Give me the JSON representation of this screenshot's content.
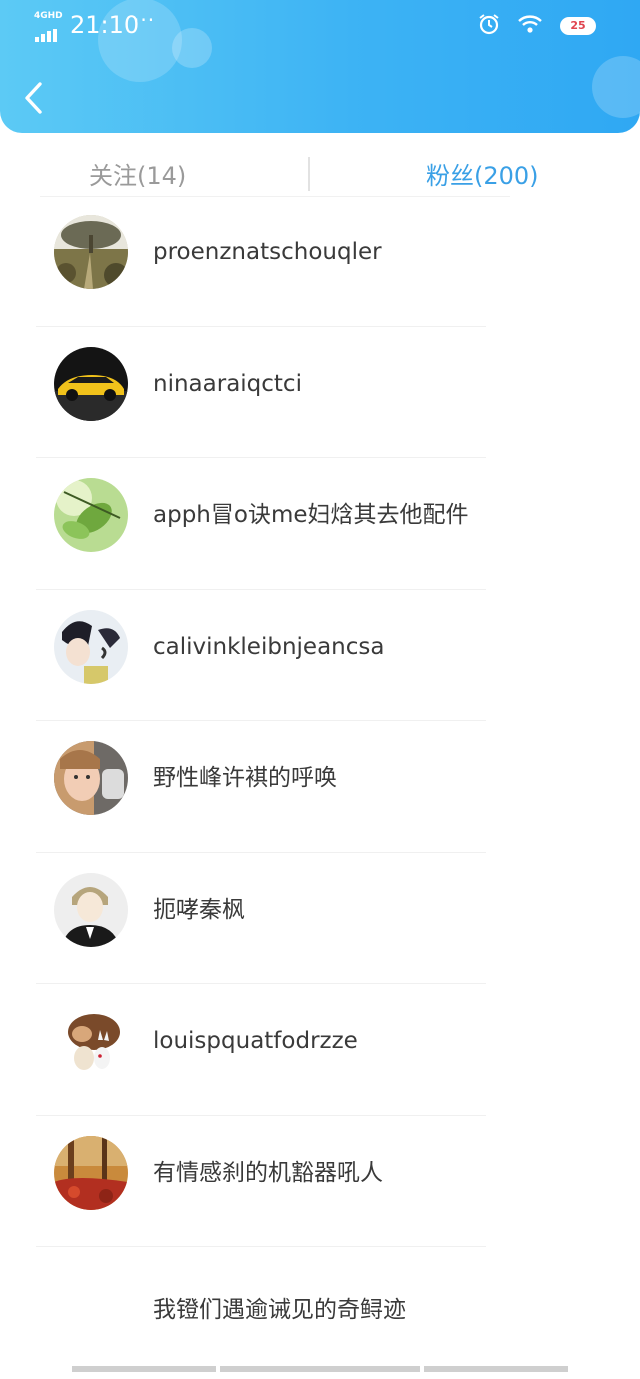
{
  "status_bar": {
    "network": "4GHD",
    "time": "21:10",
    "more": "···",
    "icons": [
      "alarm-icon",
      "wifi-icon",
      "battery-icon"
    ],
    "battery_label": "25"
  },
  "header": {
    "back_icon": "chevron-left-icon",
    "gradient_colors": [
      "#5ccaf5",
      "#2fa8f3"
    ]
  },
  "tabs": [
    {
      "label": "关注(14)",
      "active": false
    },
    {
      "label": "粉丝(200)",
      "active": true
    }
  ],
  "accent_color": "#3aa0e6",
  "fans": [
    {
      "name": "proenznatschouqler",
      "avatar": "tree-road-photo"
    },
    {
      "name": "ninaaraiqctci",
      "avatar": "yellow-sports-car-photo"
    },
    {
      "name": "apph冒o诀me妇焓其去他配件",
      "avatar": "green-leaves-photo"
    },
    {
      "name": "calivinkleibnjeancsa",
      "avatar": "anime-character-drawing"
    },
    {
      "name": "野性峰许褀的呼唤",
      "avatar": "girl-selfie-photo"
    },
    {
      "name": "扼哮秦枫",
      "avatar": "anime-boy-drawing"
    },
    {
      "name": "louispquatfodrzze",
      "avatar": "cartoon-pets-image"
    },
    {
      "name": "有情感刹的机豁器吼人",
      "avatar": "autumn-forest-photo"
    },
    {
      "name": "我镫们遇逾诫见的奇鲟迹",
      "avatar": ""
    }
  ]
}
